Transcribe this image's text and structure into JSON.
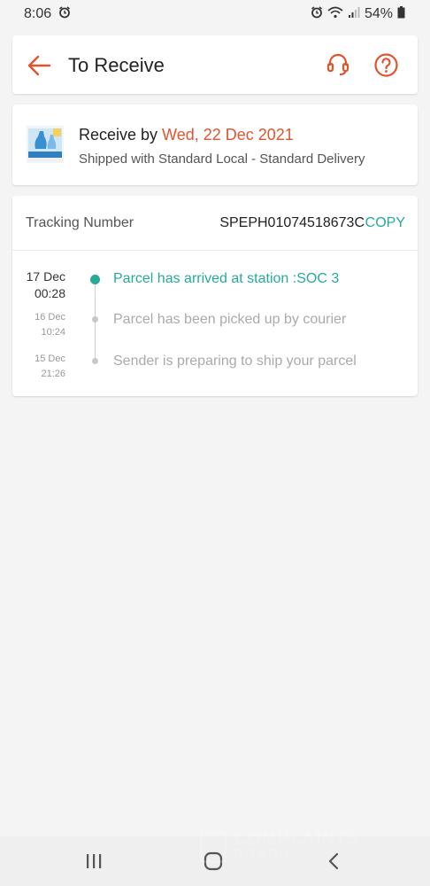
{
  "status_bar": {
    "time": "8:06",
    "battery": "54%",
    "icons": [
      "alarm-icon",
      "alarm-icon",
      "wifi-icon",
      "signal-icon",
      "battery-icon"
    ]
  },
  "header": {
    "title": "To Receive",
    "icons": [
      "arrow-left-icon",
      "headset-icon",
      "question-circle-icon"
    ]
  },
  "receive": {
    "prefix": "Receive by ",
    "date": "Wed, 22 Dec 2021",
    "shipping": "Shipped with Standard Local - Standard Delivery"
  },
  "tracking": {
    "label": "Tracking Number",
    "number": "SPEPH01074518673C",
    "copy_label": "COPY",
    "events": [
      {
        "date": "17 Dec",
        "time": "00:28",
        "description": "Parcel has arrived at station :SOC 3",
        "active": true
      },
      {
        "date": "16 Dec",
        "time": "10:24",
        "description": "Parcel has been picked up by courier",
        "active": false
      },
      {
        "date": "15 Dec",
        "time": "21:26",
        "description": "Sender is preparing to ship your parcel",
        "active": false
      }
    ]
  },
  "watermark": {
    "line1": "COMPLAINTS",
    "line2": "BOARD"
  },
  "colors": {
    "accent": "#e0542e",
    "teal": "#26aa99",
    "background": "#f4f4f4"
  }
}
